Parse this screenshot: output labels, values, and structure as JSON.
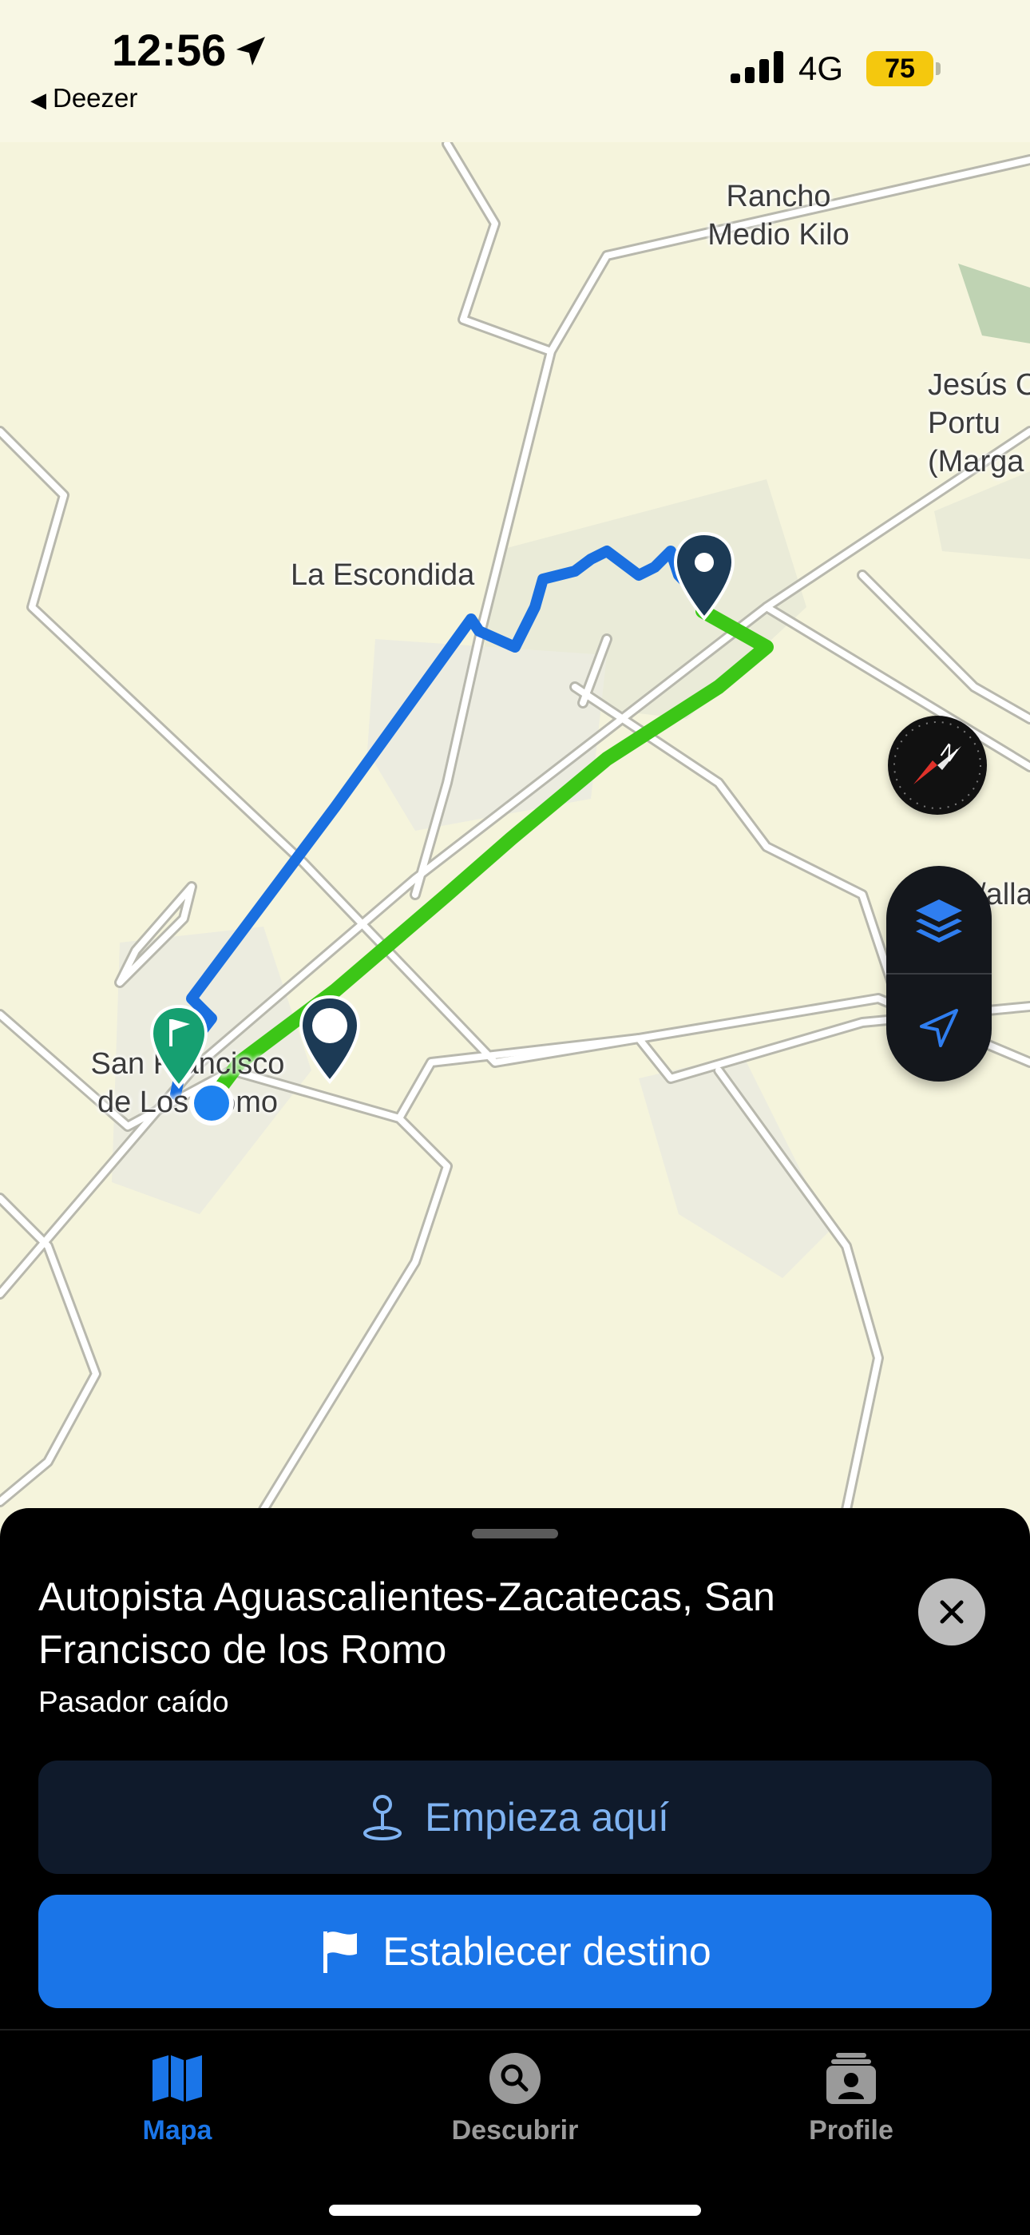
{
  "status_bar": {
    "time": "12:56",
    "back_app": "Deezer",
    "network": "4G",
    "battery": "75"
  },
  "map": {
    "labels": {
      "rancho": "Rancho\nMedio Kilo",
      "escondida": "La Escondida",
      "jesus": "Jesús C\nPortu\n(Marga",
      "valla": "/alla",
      "sanfrancisco": "San Francisco\nde Los Romo"
    },
    "route_colors": {
      "blue": "#1a6fe0",
      "green": "#3cc617"
    },
    "icons": {
      "compass": "compass-icon",
      "layers": "layers-icon",
      "locate": "location-arrow-icon",
      "pin": "map-pin-icon",
      "flag": "flag-pin-icon",
      "user": "user-location-icon"
    }
  },
  "sheet": {
    "title": "Autopista Aguascalientes-Zacatecas, San Francisco de los Romo",
    "subtitle": "Pasador caído",
    "start_label": "Empieza aquí",
    "destination_label": "Establecer destino"
  },
  "tabs": [
    {
      "label": "Mapa",
      "icon": "map-icon",
      "active": true
    },
    {
      "label": "Descubrir",
      "icon": "search-icon",
      "active": false
    },
    {
      "label": "Profile",
      "icon": "profile-icon",
      "active": false
    }
  ],
  "colors": {
    "accent": "#1a75e8",
    "active_tab": "#1a75e8",
    "inactive_tab": "#9a9a9a"
  }
}
